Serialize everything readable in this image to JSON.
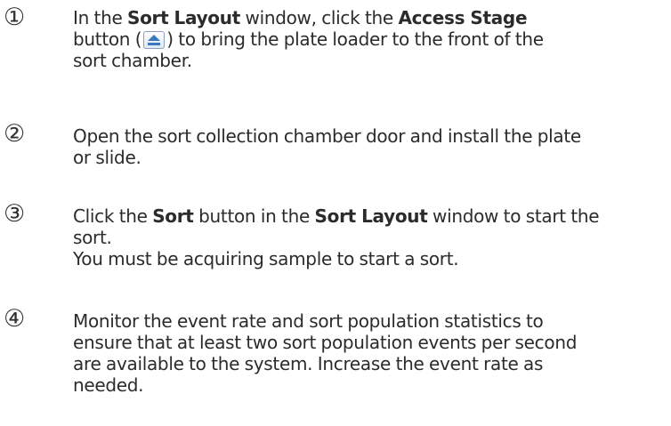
{
  "steps": [
    {
      "number": "①",
      "line1_pre": "In the ",
      "line1_b1": "Sort Layout",
      "line1_mid": " window, click the ",
      "line1_b2": "Access Stage",
      "line2_pre": " button (",
      "line2_post": ") to bring the plate loader to the front of the",
      "line3": "sort chamber.",
      "button_icon": "eject-icon"
    },
    {
      "number": "②",
      "line1": "Open the sort collection chamber door and install the plate",
      "line2": "or slide."
    },
    {
      "number": "③",
      "line1_pre": "Click the ",
      "line1_b1": "Sort",
      "line1_mid": " button in the ",
      "line1_b2": "Sort Layout",
      "line1_post": " window to start the",
      "line2": "sort.",
      "line3": "You must be acquiring sample to start a sort."
    },
    {
      "number": "④",
      "line1": "Monitor the event rate and sort population statistics to",
      "line2": "ensure that at least two sort population events per second",
      "line3": "are available to the system. Increase the event rate as",
      "line4": "needed."
    }
  ],
  "colors": {
    "text": "#2b2b2b",
    "button_border": "#8aa2bd",
    "icon_fill": "#3a78c2"
  }
}
